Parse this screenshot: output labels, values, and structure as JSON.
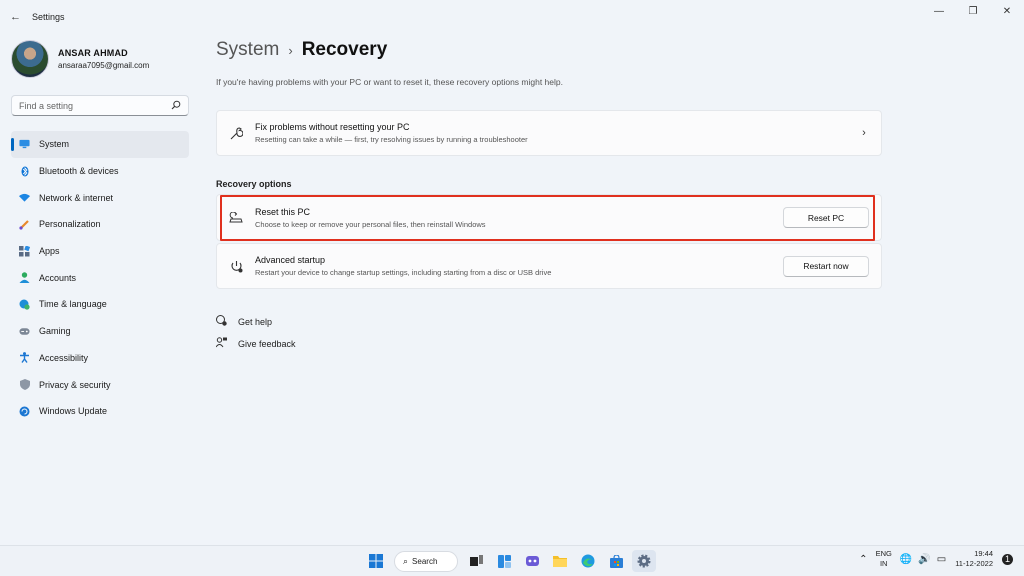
{
  "window": {
    "title": "Settings",
    "back_icon": "←",
    "controls": [
      "—",
      "❐",
      "✕"
    ]
  },
  "profile": {
    "name": "ANSAR AHMAD",
    "email": "ansaraa7095@gmail.com"
  },
  "search": {
    "placeholder": "Find a setting"
  },
  "nav": {
    "items": [
      {
        "label": "System",
        "icon": "monitor-icon",
        "active": true
      },
      {
        "label": "Bluetooth & devices",
        "icon": "bluetooth-icon"
      },
      {
        "label": "Network & internet",
        "icon": "wifi-icon"
      },
      {
        "label": "Personalization",
        "icon": "brush-icon"
      },
      {
        "label": "Apps",
        "icon": "apps-icon"
      },
      {
        "label": "Accounts",
        "icon": "person-icon"
      },
      {
        "label": "Time & language",
        "icon": "globe-clock-icon"
      },
      {
        "label": "Gaming",
        "icon": "gamepad-icon"
      },
      {
        "label": "Accessibility",
        "icon": "accessibility-icon"
      },
      {
        "label": "Privacy & security",
        "icon": "shield-icon"
      },
      {
        "label": "Windows Update",
        "icon": "update-icon"
      }
    ]
  },
  "breadcrumb": {
    "parent": "System",
    "separator": "›",
    "current": "Recovery"
  },
  "subtitle": "If you're having problems with your PC or want to reset it, these recovery options might help.",
  "fix_card": {
    "title": "Fix problems without resetting your PC",
    "desc": "Resetting can take a while — first, try resolving issues by running a troubleshooter"
  },
  "recovery_options": {
    "heading": "Recovery options",
    "reset": {
      "title": "Reset this PC",
      "desc": "Choose to keep or remove your personal files, then reinstall Windows",
      "button": "Reset PC"
    },
    "advanced": {
      "title": "Advanced startup",
      "desc": "Restart your device to change startup settings, including starting from a disc or USB drive",
      "button": "Restart now"
    }
  },
  "links": {
    "help": "Get help",
    "feedback": "Give feedback"
  },
  "taskbar": {
    "search_label": "Search",
    "lang_top": "ENG",
    "lang_bottom": "IN",
    "time": "19:44",
    "date": "11-12-2022"
  },
  "colors": {
    "accent": "#0067c0",
    "highlight": "#e0301e",
    "background": "#f0f4f9"
  }
}
